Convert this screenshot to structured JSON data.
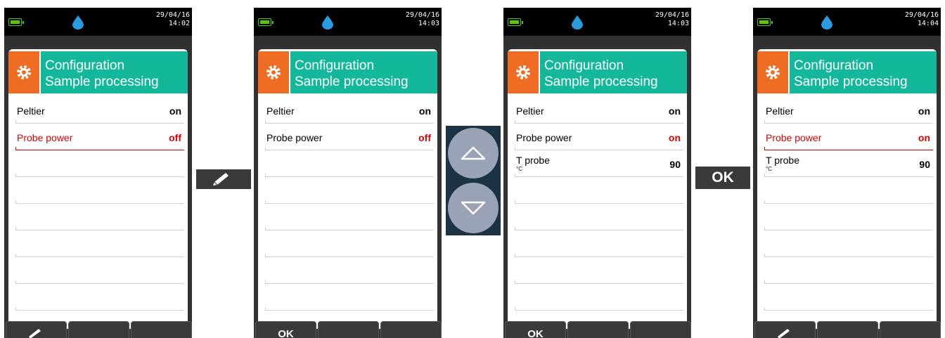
{
  "screens": [
    {
      "date": "29/04/16",
      "time": "14:02",
      "header": {
        "line1": "Configuration",
        "line2": "Sample processing"
      },
      "rows": [
        {
          "label": "Peltier",
          "value": "on"
        },
        {
          "label": "Probe power",
          "value": "off"
        }
      ],
      "softkeys": {
        "left": "pencil-icon",
        "middle": "",
        "right": ""
      }
    },
    {
      "date": "29/04/16",
      "time": "14:03",
      "header": {
        "line1": "Configuration",
        "line2": "Sample processing"
      },
      "rows": [
        {
          "label": "Peltier",
          "value": "on"
        },
        {
          "label": "Probe power",
          "value": "off"
        }
      ],
      "softkeys": {
        "left": "OK",
        "middle": "",
        "right": ""
      }
    },
    {
      "date": "29/04/16",
      "time": "14:03",
      "header": {
        "line1": "Configuration",
        "line2": "Sample processing"
      },
      "rows": [
        {
          "label": "Peltier",
          "value": "on"
        },
        {
          "label": "Probe power",
          "value": "on"
        },
        {
          "label": "T probe",
          "unit": "°C",
          "value": "90"
        }
      ],
      "softkeys": {
        "left": "OK",
        "middle": "",
        "right": ""
      }
    },
    {
      "date": "29/04/16",
      "time": "14:04",
      "header": {
        "line1": "Configuration",
        "line2": "Sample processing"
      },
      "rows": [
        {
          "label": "Peltier",
          "value": "on"
        },
        {
          "label": "Probe power",
          "value": "on"
        },
        {
          "label": "T probe",
          "unit": "°C",
          "value": "90"
        }
      ],
      "softkeys": {
        "left": "pencil-icon",
        "middle": "",
        "right": ""
      }
    }
  ],
  "keys": {
    "edit": "pencil-icon",
    "up": "arrow-up-icon",
    "down": "arrow-down-icon",
    "ok": "OK"
  },
  "colors": {
    "accent_teal": "#13b89a",
    "accent_orange": "#ef6c23",
    "selected_red": "#d80000",
    "battery_green": "#58c800",
    "drop_blue": "#2a9be0"
  }
}
